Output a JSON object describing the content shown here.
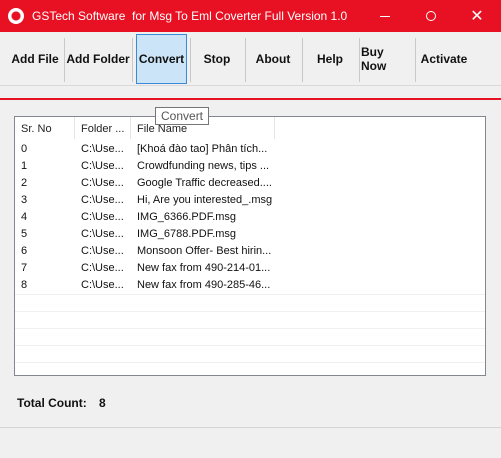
{
  "window": {
    "title": "GSTech Software  for Msg To Eml Coverter Full Version 1.0",
    "accent_color": "#e81123",
    "controls": {
      "minimize_icon": "minimize-icon",
      "maximize_icon": "maximize-icon",
      "close_icon": "close-icon",
      "close_glyph": "✕"
    }
  },
  "toolbar": {
    "buttons": [
      {
        "label": "Add File"
      },
      {
        "label": "Add Folder"
      },
      {
        "label": "Convert"
      },
      {
        "label": "Stop"
      },
      {
        "label": "About"
      },
      {
        "label": "Help"
      },
      {
        "label": "Buy Now"
      },
      {
        "label": "Activate"
      }
    ]
  },
  "tooltip": {
    "text": "Convert"
  },
  "table": {
    "columns": [
      "Sr. No",
      "Folder ...",
      "File Name"
    ],
    "rows": [
      [
        "0",
        "C:\\Use...",
        "[Khoá đào tao] Phân tích..."
      ],
      [
        "1",
        "C:\\Use...",
        "Crowdfunding news, tips ..."
      ],
      [
        "2",
        "C:\\Use...",
        "Google Traffic decreased...."
      ],
      [
        "3",
        "C:\\Use...",
        "Hi, Are you interested_.msg"
      ],
      [
        "4",
        "C:\\Use...",
        "IMG_6366.PDF.msg"
      ],
      [
        "5",
        "C:\\Use...",
        "IMG_6788.PDF.msg"
      ],
      [
        "6",
        "C:\\Use...",
        "Monsoon Offer- Best hirin..."
      ],
      [
        "7",
        "C:\\Use...",
        "New fax from 490-214-01..."
      ],
      [
        "8",
        "C:\\Use...",
        "New fax from 490-285-46..."
      ]
    ]
  },
  "footer": {
    "total_label": "Total Count:",
    "total_value": "8"
  }
}
